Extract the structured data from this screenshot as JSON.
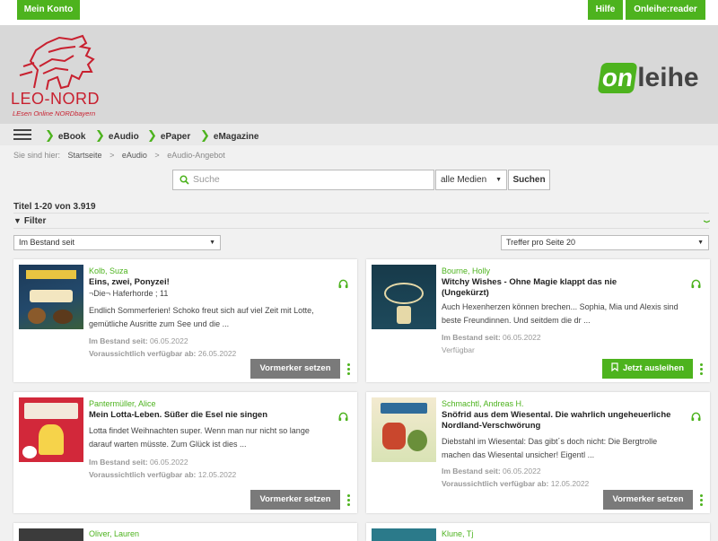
{
  "header": {
    "account_button": "Mein Konto",
    "help_button": "Hilfe",
    "reader_button": "Onleihe:reader"
  },
  "brand": {
    "library_name": "LEO-NORD",
    "library_tagline": "LEsen Online NORDbayern",
    "service_logo_on": "on",
    "service_logo_leihe": "leihe",
    "accent": "#4db31e",
    "logo_red": "#c8202f"
  },
  "nav": {
    "items": [
      "eBook",
      "eAudio",
      "ePaper",
      "eMagazine"
    ]
  },
  "breadcrumb": {
    "prefix": "Sie sind hier:",
    "items": [
      "Startseite",
      "eAudio",
      "eAudio-Angebot"
    ],
    "separator": ">"
  },
  "search": {
    "placeholder": "Suche",
    "media_select": "alle Medien",
    "submit": "Suchen"
  },
  "results": {
    "count_label": "Titel 1-20 von 3.919",
    "filter_label": "Filter",
    "sort_select": "Im Bestand seit",
    "per_page_select": "Treffer pro Seite 20"
  },
  "cards": [
    {
      "author": "Kolb, Suza",
      "title": "Eins, zwei, Ponyzei!",
      "series": "¬Die¬ Haferhorde ; 11",
      "desc1": "Endlich Sommerferien! Schoko freut sich auf viel Zeit mit Lotte,",
      "desc2": "gemütliche Ausritte zum See und die ...",
      "stock_label": "Im Bestand seit:",
      "stock_date": "06.05.2022",
      "avail_label": "Voraussichtlich verfügbar ab:",
      "avail_date": "26.05.2022",
      "button": "Vormerker setzen"
    },
    {
      "author": "Bourne, Holly",
      "title": "Witchy Wishes - Ohne Magie klappt das nie (Ungekürzt)",
      "desc1": "Auch Hexenherzen können brechen... Sophia, Mia und Alexis sind",
      "desc2": "beste Freundinnen. Und seitdem die dr ...",
      "stock_label": "Im Bestand seit:",
      "stock_date": "06.05.2022",
      "status": "Verfügbar",
      "button": "Jetzt ausleihen"
    },
    {
      "author": "Pantermüller, Alice",
      "title": "Mein Lotta-Leben. Süßer die Esel nie singen",
      "desc1": "Lotta findet Weihnachten super. Wenn man nur nicht so lange",
      "desc2": "darauf warten müsste. Zum Glück ist dies ...",
      "stock_label": "Im Bestand seit:",
      "stock_date": "06.05.2022",
      "avail_label": "Voraussichtlich verfügbar ab:",
      "avail_date": "12.05.2022",
      "button": "Vormerker setzen"
    },
    {
      "author": "Schmachtl, Andreas H.",
      "title": "Snöfrid aus dem Wiesental. Die wahrlich ungeheuerliche Nordland-Verschwörung",
      "desc1": "Diebstahl im Wiesental: Das gibt´s doch nicht: Die Bergtrolle",
      "desc2": "machen das Wiesental unsicher! Eigentl ...",
      "stock_label": "Im Bestand seit:",
      "stock_date": "06.05.2022",
      "avail_label": "Voraussichtlich verfügbar ab:",
      "avail_date": "12.05.2022",
      "button": "Vormerker setzen"
    },
    {
      "author": "Oliver, Lauren"
    },
    {
      "author": "Klune, Tj"
    }
  ]
}
